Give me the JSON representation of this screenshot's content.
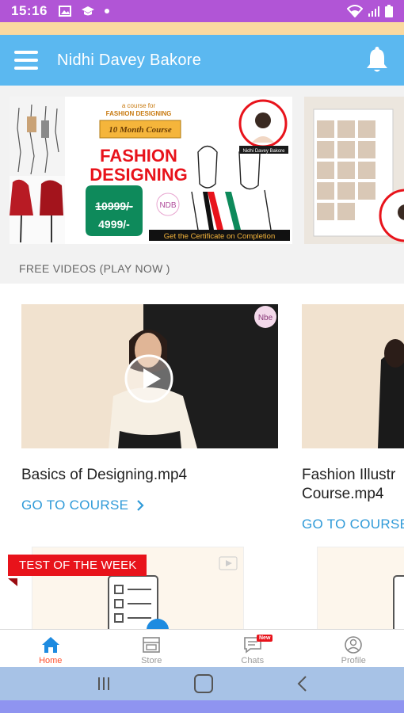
{
  "status_bar": {
    "time": "15:16"
  },
  "app_bar": {
    "title": "Nidhi Davey Bakore"
  },
  "banner": {
    "course_for": "a course for",
    "course_for_sub": "FASHION DESIGNING",
    "duration": "10 Month Course",
    "headline_1": "FASHION",
    "headline_2": "DESIGNING",
    "old_price": "10999/-",
    "new_price": "4999/-",
    "certificate": "Get the Certificate on Completion",
    "presenter": "Nidhi Davey Bakore",
    "logo": "NDB"
  },
  "section": {
    "free_videos": "FREE VIDEOS (PLAY NOW )"
  },
  "videos": [
    {
      "title": "Basics of Designing.mp4",
      "cta": "GO TO COURSE",
      "logo": "Nbe"
    },
    {
      "title_line1": "Fashion Illustr",
      "title_line2": "Course.mp4",
      "cta": "GO TO COURSE"
    }
  ],
  "test": {
    "ribbon": "TEST OF THE WEEK"
  },
  "bottom_nav": [
    {
      "label": "Home",
      "icon": "home-icon",
      "active": true
    },
    {
      "label": "Store",
      "icon": "store-icon",
      "active": false
    },
    {
      "label": "Chats",
      "icon": "chat-icon",
      "active": false,
      "badge": "New"
    },
    {
      "label": "Profile",
      "icon": "profile-icon",
      "active": false
    }
  ],
  "colors": {
    "status_bar": "#b155d6",
    "app_bar": "#5bb8f0",
    "link": "#2f9ad8",
    "active_nav": "#ff4e2a",
    "ribbon": "#e8131b"
  }
}
